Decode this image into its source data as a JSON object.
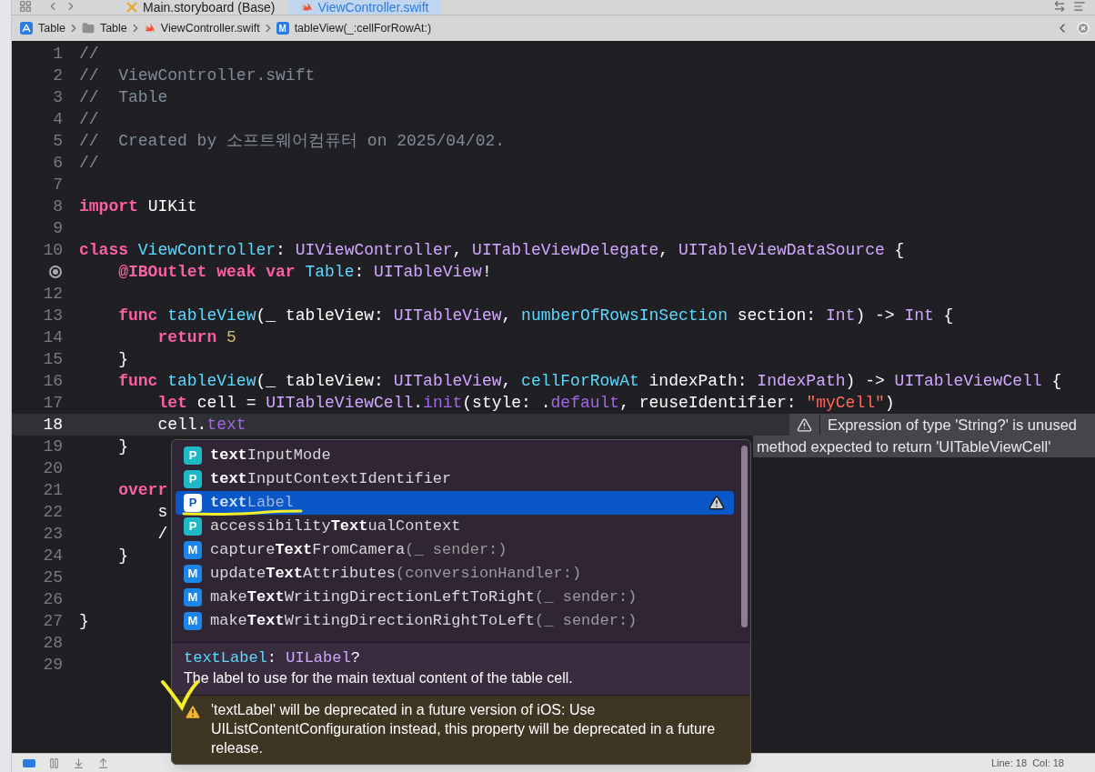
{
  "tabs": [
    {
      "label": "Main.storyboard (Base)",
      "kind": "storyboard",
      "selected": false
    },
    {
      "label": "ViewController.swift",
      "kind": "swift",
      "selected": true
    }
  ],
  "breadcrumb": [
    {
      "label": "Table",
      "kind": "app"
    },
    {
      "label": "Table",
      "kind": "folder"
    },
    {
      "label": "ViewController.swift",
      "kind": "swift"
    },
    {
      "label": "tableView(_:cellForRowAt:)",
      "kind": "method",
      "badge": "M"
    }
  ],
  "editor": {
    "lines": [
      {
        "number": "1",
        "tokens": [
          {
            "kind": "comment",
            "text": "//"
          }
        ]
      },
      {
        "number": "2",
        "tokens": [
          {
            "kind": "comment",
            "text": "//  ViewController.swift"
          }
        ]
      },
      {
        "number": "3",
        "tokens": [
          {
            "kind": "comment",
            "text": "//  Table"
          }
        ]
      },
      {
        "number": "4",
        "tokens": [
          {
            "kind": "comment",
            "text": "//"
          }
        ]
      },
      {
        "number": "5",
        "tokens": [
          {
            "kind": "comment",
            "text": "//  Created by 소프트웨어컴퓨터 on 2025/04/02."
          }
        ]
      },
      {
        "number": "6",
        "tokens": [
          {
            "kind": "comment",
            "text": "//"
          }
        ]
      },
      {
        "number": "7"
      },
      {
        "number": "8",
        "tokens": [
          {
            "kind": "keyword",
            "text": "import "
          },
          {
            "kind": "plain",
            "text": "UIKit"
          }
        ]
      },
      {
        "number": "9"
      },
      {
        "number": "10",
        "tokens": [
          {
            "kind": "keyword",
            "text": "class "
          },
          {
            "kind": "declaration",
            "text": "ViewController"
          },
          {
            "kind": "plain",
            "text": ": "
          },
          {
            "kind": "type",
            "text": "UIViewController"
          },
          {
            "kind": "plain",
            "text": ", "
          },
          {
            "kind": "type",
            "text": "UITableViewDelegate"
          },
          {
            "kind": "plain",
            "text": ", "
          },
          {
            "kind": "type",
            "text": "UITableViewDataSource"
          },
          {
            "kind": "plain",
            "text": " {"
          }
        ]
      },
      {
        "outlet_connected": true,
        "tokens": [
          {
            "kind": "keyword",
            "text": "    @IBOutlet weak var "
          },
          {
            "kind": "declaration",
            "text": "Table"
          },
          {
            "kind": "plain",
            "text": ": "
          },
          {
            "kind": "type",
            "text": "UITableView"
          },
          {
            "kind": "plain",
            "text": "!"
          }
        ]
      },
      {
        "number": "12"
      },
      {
        "number": "13",
        "tokens": [
          {
            "kind": "keyword",
            "text": "    func "
          },
          {
            "kind": "declaration",
            "text": "tableView"
          },
          {
            "kind": "plain",
            "text": "(_ tableView: "
          },
          {
            "kind": "type",
            "text": "UITableView"
          },
          {
            "kind": "plain",
            "text": ", "
          },
          {
            "kind": "declaration",
            "text": "numberOfRowsInSection"
          },
          {
            "kind": "plain",
            "text": " section: "
          },
          {
            "kind": "type",
            "text": "Int"
          },
          {
            "kind": "plain",
            "text": ") -> "
          },
          {
            "kind": "type",
            "text": "Int"
          },
          {
            "kind": "plain",
            "text": " {"
          }
        ]
      },
      {
        "number": "14",
        "tokens": [
          {
            "kind": "keyword",
            "text": "        return "
          },
          {
            "kind": "number",
            "text": "5"
          }
        ]
      },
      {
        "number": "15",
        "tokens": [
          {
            "kind": "plain",
            "text": "    }"
          }
        ]
      },
      {
        "number": "16",
        "tokens": [
          {
            "kind": "keyword",
            "text": "    func "
          },
          {
            "kind": "declaration",
            "text": "tableView"
          },
          {
            "kind": "plain",
            "text": "(_ tableView: "
          },
          {
            "kind": "type",
            "text": "UITableView"
          },
          {
            "kind": "plain",
            "text": ", "
          },
          {
            "kind": "declaration",
            "text": "cellForRowAt"
          },
          {
            "kind": "plain",
            "text": " indexPath: "
          },
          {
            "kind": "type",
            "text": "IndexPath"
          },
          {
            "kind": "plain",
            "text": ") -> "
          },
          {
            "kind": "type",
            "text": "UITableViewCell"
          },
          {
            "kind": "plain",
            "text": " {"
          }
        ]
      },
      {
        "number": "17",
        "tokens": [
          {
            "kind": "keyword",
            "text": "        let "
          },
          {
            "kind": "plain",
            "text": "cell = "
          },
          {
            "kind": "type",
            "text": "UITableViewCell"
          },
          {
            "kind": "plain",
            "text": "."
          },
          {
            "kind": "member",
            "text": "init"
          },
          {
            "kind": "plain",
            "text": "(style: ."
          },
          {
            "kind": "member",
            "text": "default"
          },
          {
            "kind": "plain",
            "text": ", reuseIdentifier: "
          },
          {
            "kind": "string",
            "text": "\"myCell\""
          },
          {
            "kind": "plain",
            "text": ")"
          }
        ]
      },
      {
        "number": "18",
        "current": true,
        "tokens": [
          {
            "kind": "plain",
            "text": "        cell."
          },
          {
            "kind": "member",
            "text": "text"
          }
        ],
        "annotation": {
          "kind": "warning",
          "text": "Expression of type 'String?' is unused"
        }
      },
      {
        "number": "19",
        "tokens": [
          {
            "kind": "plain",
            "text": "    }"
          }
        ],
        "annotation": {
          "kind": "error",
          "text": "method expected to return 'UITableViewCell'"
        }
      },
      {
        "number": "20"
      },
      {
        "number": "21",
        "tokens": [
          {
            "kind": "keyword",
            "text": "    overr"
          }
        ]
      },
      {
        "number": "22",
        "tokens": [
          {
            "kind": "plain",
            "text": "        s"
          }
        ]
      },
      {
        "number": "23",
        "tokens": [
          {
            "kind": "plain",
            "text": "        /"
          }
        ]
      },
      {
        "number": "24",
        "tokens": [
          {
            "kind": "plain",
            "text": "    }"
          }
        ]
      },
      {
        "number": "25"
      },
      {
        "number": "26"
      },
      {
        "number": "27",
        "tokens": [
          {
            "kind": "plain",
            "text": "}"
          }
        ]
      },
      {
        "number": "28"
      },
      {
        "number": "29"
      }
    ]
  },
  "completion": {
    "items": [
      {
        "badge": "P",
        "kind": "property",
        "selected": false,
        "warning": false,
        "segments": [
          {
            "kind": "match",
            "text": "text"
          },
          {
            "kind": "name",
            "text": "InputMode"
          }
        ]
      },
      {
        "badge": "P",
        "kind": "property",
        "selected": false,
        "warning": false,
        "segments": [
          {
            "kind": "match",
            "text": "text"
          },
          {
            "kind": "name",
            "text": "InputContextIdentifier"
          }
        ]
      },
      {
        "badge": "P",
        "kind": "property",
        "selected": true,
        "warning": true,
        "segments": [
          {
            "kind": "match",
            "text": "text"
          },
          {
            "kind": "name",
            "text": "Label"
          }
        ]
      },
      {
        "badge": "P",
        "kind": "property",
        "selected": false,
        "warning": false,
        "segments": [
          {
            "kind": "name",
            "text": "accessibility"
          },
          {
            "kind": "match",
            "text": "Text"
          },
          {
            "kind": "name",
            "text": "ualContext"
          }
        ]
      },
      {
        "badge": "M",
        "kind": "method",
        "selected": false,
        "warning": false,
        "segments": [
          {
            "kind": "name",
            "text": "capture"
          },
          {
            "kind": "match",
            "text": "Text"
          },
          {
            "kind": "name",
            "text": "FromCamera"
          },
          {
            "kind": "args",
            "text": "(_ sender:)"
          }
        ]
      },
      {
        "badge": "M",
        "kind": "method",
        "selected": false,
        "warning": false,
        "segments": [
          {
            "kind": "name",
            "text": "update"
          },
          {
            "kind": "match",
            "text": "Text"
          },
          {
            "kind": "name",
            "text": "Attributes"
          },
          {
            "kind": "args",
            "text": "(conversionHandler:)"
          }
        ]
      },
      {
        "badge": "M",
        "kind": "method",
        "selected": false,
        "warning": false,
        "segments": [
          {
            "kind": "name",
            "text": "make"
          },
          {
            "kind": "match",
            "text": "Text"
          },
          {
            "kind": "name",
            "text": "WritingDirectionLeftToRight"
          },
          {
            "kind": "args",
            "text": "(_ sender:)"
          }
        ]
      },
      {
        "badge": "M",
        "kind": "method",
        "selected": false,
        "warning": false,
        "segments": [
          {
            "kind": "name",
            "text": "make"
          },
          {
            "kind": "match",
            "text": "Text"
          },
          {
            "kind": "name",
            "text": "WritingDirectionRightToLeft"
          },
          {
            "kind": "args",
            "text": "(_ sender:)"
          }
        ]
      }
    ],
    "doc": {
      "signature": [
        {
          "kind": "name",
          "text": "textLabel"
        },
        {
          "kind": "plain",
          "text": ": "
        },
        {
          "kind": "type",
          "text": "UILabel"
        },
        {
          "kind": "plain",
          "text": "?"
        }
      ],
      "summary": "The label to use for the main textual content of the table cell.",
      "warning": "'textLabel' will be deprecated in a future version of iOS: Use UIListContentConfiguration instead, this property will be deprecated in a future release."
    }
  },
  "status_bar": {
    "position": "Line: 18  Col: 18"
  }
}
